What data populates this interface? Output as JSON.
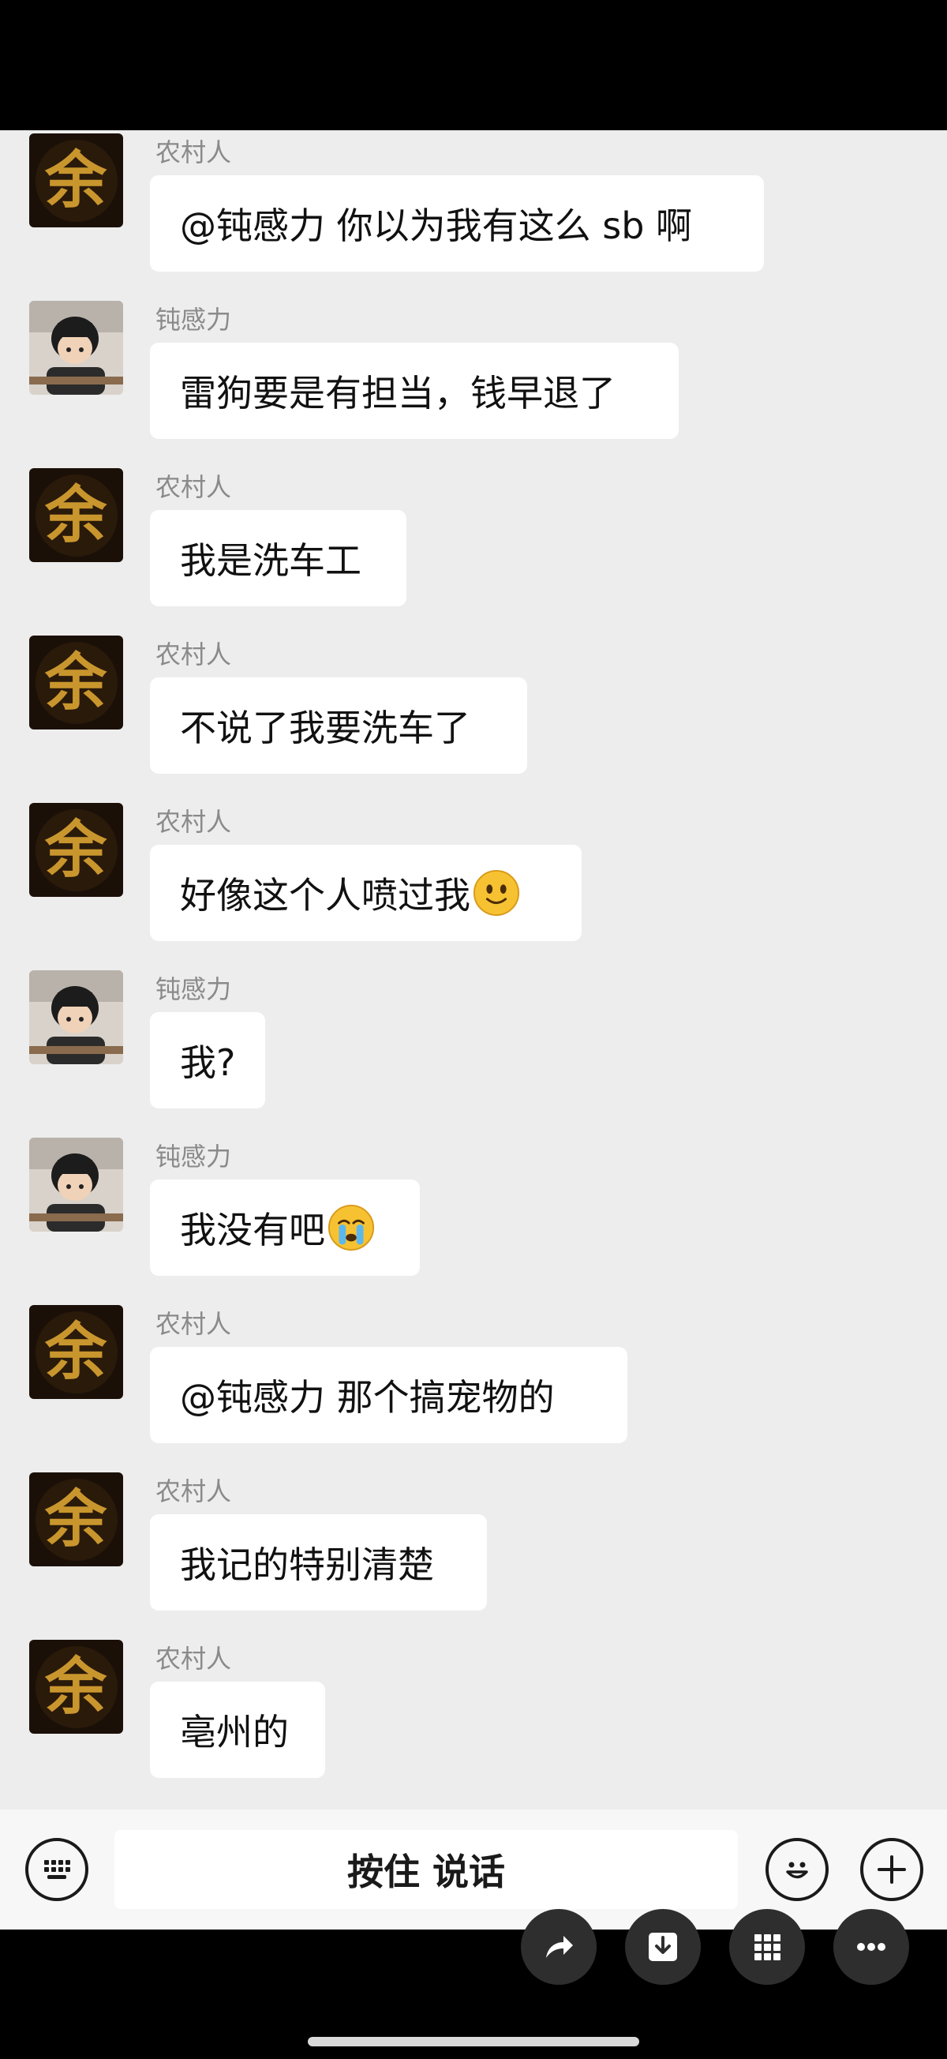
{
  "senders": {
    "nongcun": "农村人",
    "dunganli": "钝感力"
  },
  "messages": [
    {
      "sender": "农村人",
      "text": "@钝感力  你以为我有这么 sb 啊"
    },
    {
      "sender": "钝感力",
      "text": "雷狗要是有担当，钱早退了"
    },
    {
      "sender": "农村人",
      "text": "我是洗车工"
    },
    {
      "sender": "农村人",
      "text": "不说了我要洗车了"
    },
    {
      "sender": "农村人",
      "text": "好像这个人喷过我",
      "emoji": "smile-emoji"
    },
    {
      "sender": "钝感力",
      "text": "我?"
    },
    {
      "sender": "钝感力",
      "text": "我没有吧",
      "emoji": "crying-emoji"
    },
    {
      "sender": "农村人",
      "text": "@钝感力  那个搞宠物的"
    },
    {
      "sender": "农村人",
      "text": "我记的特别清楚"
    },
    {
      "sender": "农村人",
      "text": "亳州的"
    }
  ],
  "input_bar": {
    "voice_label": "按住 说话",
    "left_icon": "keyboard-icon",
    "right_icons": [
      "emoji-icon",
      "plus-icon"
    ]
  },
  "floating_actions": [
    "share-icon",
    "download-icon",
    "grid-icon",
    "more-icon"
  ],
  "colors": {
    "chat_bg": "#ededed",
    "bubble_bg": "#ffffff",
    "sender_name": "#8a8a8a",
    "avatar_gold": "#c9962e"
  }
}
